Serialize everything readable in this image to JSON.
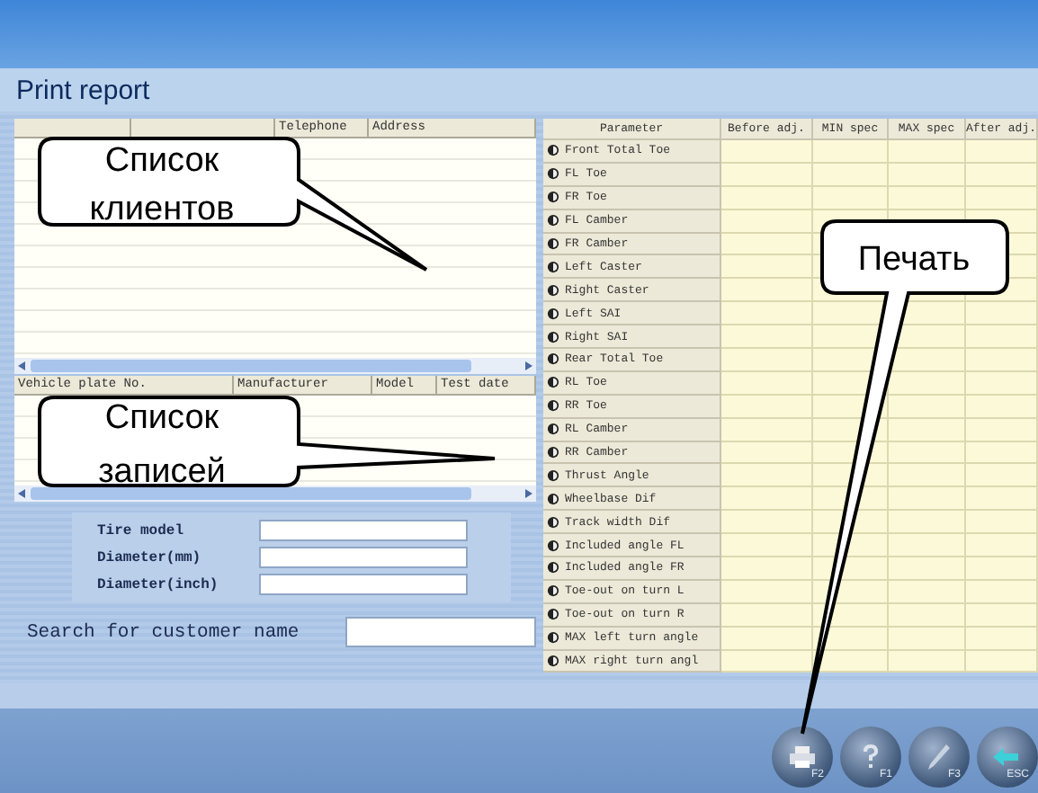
{
  "title": "Print report",
  "clients_table": {
    "columns": [
      {},
      {},
      {
        "label": "Telephone"
      },
      {
        "label": "Address"
      }
    ]
  },
  "records_table": {
    "columns": [
      {
        "label": "Vehicle plate No."
      },
      {
        "label": "Manufacturer"
      },
      {
        "label": "Model"
      },
      {
        "label": "Test date"
      }
    ]
  },
  "tire_form": [
    {
      "label": "Tire model"
    },
    {
      "label": "Diameter(mm)"
    },
    {
      "label": "Diameter(inch)"
    }
  ],
  "search": {
    "label": "Search for customer name"
  },
  "results_table": {
    "columns": [
      "Parameter",
      "Before adj.",
      "MIN spec",
      "MAX spec",
      "After adj."
    ],
    "rows": [
      "Front Total Toe",
      "FL Toe",
      "FR Toe",
      "FL Camber",
      "FR Camber",
      "Left Caster",
      "Right Caster",
      "Left SAI",
      "Right SAI",
      "Rear Total Toe",
      "RL Toe",
      "RR Toe",
      "RL Camber",
      "RR Camber",
      "Thrust Angle",
      "Wheelbase Dif",
      "Track width Dif",
      "Included angle FL",
      "Included angle FR",
      "Toe-out on turn L",
      "Toe-out on turn R",
      "MAX left turn angle",
      "MAX right turn angl"
    ]
  },
  "toolbar": [
    {
      "kind": "print",
      "key": "F2"
    },
    {
      "kind": "help",
      "key": "F1"
    },
    {
      "kind": "tool",
      "key": "F3"
    },
    {
      "kind": "exit",
      "key": "ESC"
    }
  ],
  "callouts": [
    {
      "lines": [
        "Список",
        "клиентов"
      ]
    },
    {
      "lines": [
        "Список",
        "записей"
      ]
    },
    {
      "lines": [
        "Печать"
      ]
    }
  ]
}
